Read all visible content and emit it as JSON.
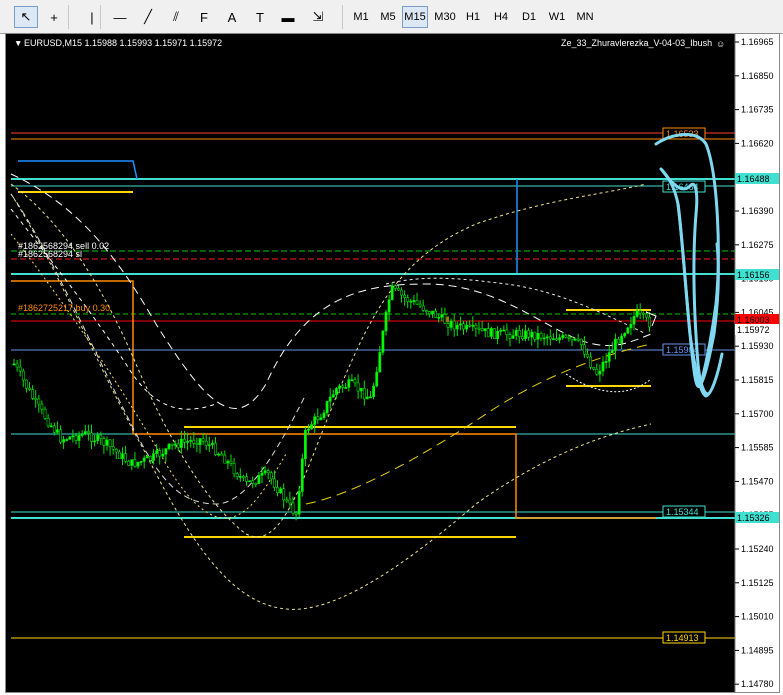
{
  "toolbar": {
    "tools": [
      {
        "name": "cursor-icon",
        "glyph": "↖"
      },
      {
        "name": "crosshair-icon",
        "glyph": "+"
      },
      {
        "name": "vertical-line-icon",
        "glyph": "|"
      },
      {
        "name": "horizontal-line-icon",
        "glyph": "—"
      },
      {
        "name": "trendline-icon",
        "glyph": "╱"
      },
      {
        "name": "equidistant-channel-icon",
        "glyph": "⫽"
      },
      {
        "name": "fibonacci-icon",
        "glyph": "F"
      },
      {
        "name": "text-icon",
        "glyph": "A"
      },
      {
        "name": "text-label-icon",
        "glyph": "T"
      },
      {
        "name": "rectangle-icon",
        "glyph": "▬"
      },
      {
        "name": "arrows-icon",
        "glyph": "⇲"
      }
    ],
    "timeframes": [
      "M1",
      "M5",
      "M15",
      "M30",
      "H1",
      "H4",
      "D1",
      "W1",
      "MN"
    ],
    "active_timeframe": "M15"
  },
  "chart": {
    "symbol_line": "EURUSD,M15  1.15988 1.15993 1.15971 1.15972",
    "indicator": "Ze_33_Zhuravlerezka_V-04-03_Ibush",
    "smiley": "☺",
    "order_labels": [
      {
        "text": "#1862568294 sell 0.02"
      },
      {
        "text": "#1862568294 sl"
      },
      {
        "text": "#1862725217 buy 0.30"
      }
    ],
    "price_ticks": [
      "1.16965",
      "1.16850",
      "1.16735",
      "1.16620",
      "1.16505",
      "1.16390",
      "1.16275",
      "1.16160",
      "1.16045",
      "1.15930",
      "1.15815",
      "1.15700",
      "1.15585",
      "1.15470",
      "1.15355",
      "1.15240",
      "1.15125",
      "1.15010",
      "1.14895",
      "1.14780"
    ],
    "level_tags": [
      {
        "text": "1.16533",
        "color": "#ff8c00"
      },
      {
        "text": "1.16464",
        "color": "#40e0d0"
      },
      {
        "text": "1.15904",
        "color": "#6495ed"
      },
      {
        "text": "1.15344",
        "color": "#40e0d0"
      },
      {
        "text": "1.14913",
        "color": "#ffd700"
      }
    ],
    "axis_tags": [
      {
        "text": "1.16488",
        "bg": "#40e0d0",
        "fg": "#000000"
      },
      {
        "text": "1.16156",
        "bg": "#40e0d0",
        "fg": "#000000"
      },
      {
        "text": "1.16003",
        "bg": "#ff0000",
        "fg": "#ffffff"
      },
      {
        "text": "1.15972",
        "bg": "#ffffff",
        "fg": "#000000"
      },
      {
        "text": "1.15326",
        "bg": "#40e0d0",
        "fg": "#000000"
      }
    ]
  }
}
